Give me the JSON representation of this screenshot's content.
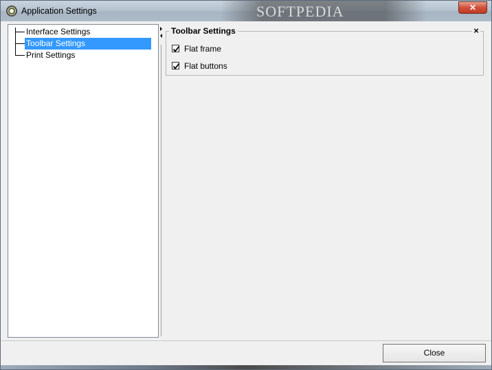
{
  "window": {
    "title": "Application Settings",
    "watermark": "SOFTPEDIA",
    "close_glyph": "✕"
  },
  "tree": {
    "items": [
      {
        "label": "Interface Settings",
        "selected": false
      },
      {
        "label": "Toolbar Settings",
        "selected": true
      },
      {
        "label": "Print Settings",
        "selected": false
      }
    ]
  },
  "panel": {
    "title": "Toolbar Settings",
    "close_glyph": "×",
    "options": [
      {
        "label": "Flat frame",
        "checked": true
      },
      {
        "label": "Flat buttons",
        "checked": true
      }
    ]
  },
  "footer": {
    "close_label": "Close"
  },
  "colors": {
    "selection": "#3399ff",
    "window_bg": "#f0f0f0"
  },
  "icons": {
    "app": "app-gear-icon",
    "close": "close-icon"
  }
}
